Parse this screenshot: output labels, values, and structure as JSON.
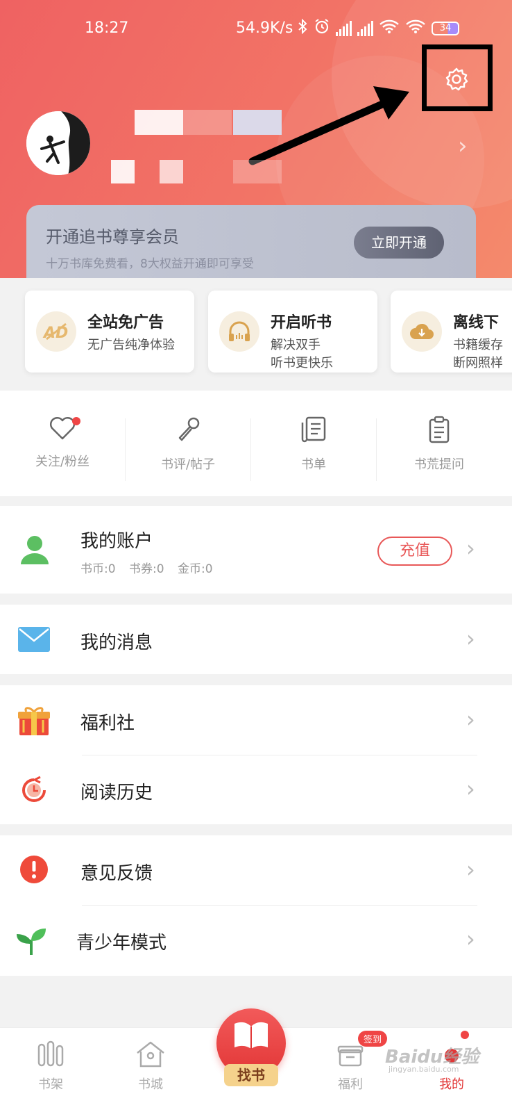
{
  "status_bar": {
    "time": "18:27",
    "network_speed": "54.9K/s",
    "battery": "34"
  },
  "vip": {
    "title": "开通追书尊享会员",
    "subtitle": "十万书库免费看，8大权益开通即可享受",
    "button": "立即开通"
  },
  "features": [
    {
      "icon": "ad-free-icon",
      "title": "全站免广告",
      "desc": [
        "无广告纯净体验"
      ]
    },
    {
      "icon": "headphones-icon",
      "title": "开启听书",
      "desc": [
        "解决双手",
        "听书更快乐"
      ]
    },
    {
      "icon": "cloud-download-icon",
      "title": "离线下",
      "desc": [
        "书籍缓存",
        "断网照样"
      ]
    }
  ],
  "quick_links": [
    {
      "label": "关注/粉丝",
      "icon": "heart-icon"
    },
    {
      "label": "书评/帖子",
      "icon": "microphone-icon"
    },
    {
      "label": "书单",
      "icon": "book-list-icon"
    },
    {
      "label": "书荒提问",
      "icon": "clipboard-icon"
    }
  ],
  "account": {
    "title": "我的账户",
    "coins": "书币:0",
    "vouchers": "书券:0",
    "gold": "金币:0",
    "recharge": "充值"
  },
  "menu": {
    "messages": "我的消息",
    "welfare": "福利社",
    "history": "阅读历史",
    "feedback": "意见反馈",
    "teen_mode": "青少年模式"
  },
  "tabbar": {
    "bookshelf": "书架",
    "bookstore": "书城",
    "find": "找书",
    "welfare": "福利",
    "sign_badge": "签到",
    "mine": "我的"
  },
  "watermark": {
    "brand": "Baidu经验",
    "url": "jingyan.baidu.com"
  }
}
